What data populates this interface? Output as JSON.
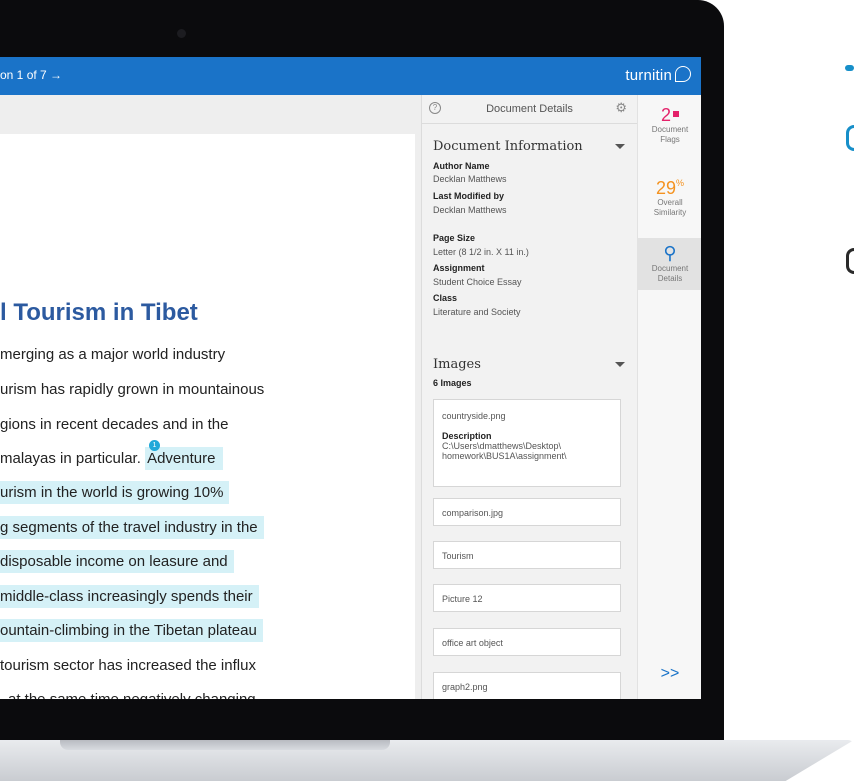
{
  "topbar": {
    "nav_text": "on 1 of 7 →",
    "brand": "turnitin"
  },
  "document": {
    "title": "l Tourism in Tibet",
    "lines": [
      {
        "text": "merging as a major world industry",
        "highlight": false
      },
      {
        "text": "urism has rapidly grown in mountainous",
        "highlight": false
      },
      {
        "text": "gions in recent decades and in the",
        "highlight": false
      },
      {
        "text": "malayas in particular.",
        "highlight": false,
        "tail": "Adventure"
      },
      {
        "text": "urism in the world is growing 10%",
        "highlight": true
      },
      {
        "text": "g segments of the travel industry in the",
        "highlight": true
      },
      {
        "text": "disposable income on leasure and",
        "highlight": true
      },
      {
        "text": "middle-class increasingly spends their",
        "highlight": true
      },
      {
        "text": "ountain-climbing in the Tibetan plateau",
        "highlight": true
      },
      {
        "text": "tourism sector has increased the influx",
        "highlight": false
      },
      {
        "text": "at the same time negatively changing",
        "highlight": false
      }
    ],
    "match_marker": "1"
  },
  "panel": {
    "header_title": "Document Details",
    "doc_info_title": "Document Information",
    "fields": [
      {
        "label": "Author Name",
        "value": "Decklan Matthews"
      },
      {
        "label": "Last Modified by",
        "value": "Decklan Matthews"
      },
      {
        "label": "Page Size",
        "value": "Letter (8 1/2 in. X 11 in.)"
      },
      {
        "label": "Assignment",
        "value": "Student Choice Essay"
      },
      {
        "label": "Class",
        "value": "Literature and Society"
      }
    ],
    "images_title": "Images",
    "images_count": "6 Images",
    "first_image": {
      "name": "countryside.png",
      "desc_label": "Description",
      "desc_line1": "C:\\Users\\dmatthews\\Desktop\\",
      "desc_line2": "homework\\BUS1A\\assignment\\"
    },
    "images": [
      "comparison.jpg",
      "Tourism",
      "Picture 12",
      "office art object",
      "graph2.png"
    ]
  },
  "rail": {
    "flags_count": "2",
    "flags_label_1": "Document",
    "flags_label_2": "Flags",
    "similarity_value": "29",
    "similarity_unit": "%",
    "similarity_label_1": "Overall",
    "similarity_label_2": "Similarity",
    "details_label_1": "Document",
    "details_label_2": "Details",
    "expand_glyph": ">>"
  },
  "colors": {
    "brand_blue": "#1a73c8",
    "flag_pink": "#e4226a",
    "similarity_orange": "#f4921f",
    "highlight": "#d5f1f7"
  }
}
